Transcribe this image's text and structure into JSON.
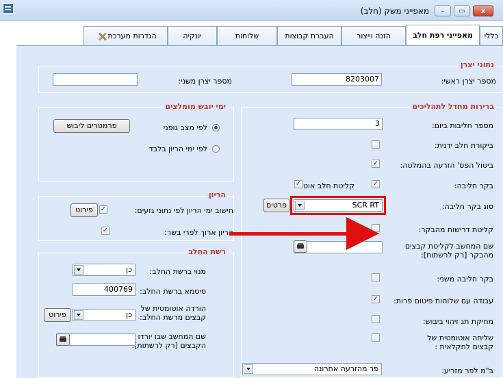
{
  "window": {
    "title": "מאפייני משק (חלב)",
    "controls": {
      "close": "x",
      "maximize": "▭",
      "minimize": "–"
    }
  },
  "tabs": [
    {
      "label": "כללי"
    },
    {
      "label": "מאפייני רפת חלב"
    },
    {
      "label": "הזנה וייצור"
    },
    {
      "label": "העברת קבוצות"
    },
    {
      "label": "שלוחות"
    },
    {
      "label": "יונקיה"
    },
    {
      "label": "הגדרות מערכת",
      "icon": "tools-icon"
    }
  ],
  "producer": {
    "title": "נתוני יצרן",
    "main_label": "מספר יצרן ראשי:",
    "main_value": "8203007",
    "secondary_label": "מספר יצרן משני:",
    "secondary_value": ""
  },
  "defaults": {
    "title": "ברירות מחדל לתהליכים",
    "milkings_label": "מספר חליבות ביום:",
    "milkings_value": "3",
    "manual_check_label": "ביקורת חלב ידנית:",
    "cancel_insem_label": "ביטול הפס' הזרעה בהמלטה:",
    "milking_ctrl_label": "בקר חליבה:",
    "auto_milk_label": "קליטת חלב אוט':",
    "ctrl_type_label": "סוג בקר חליבה:",
    "ctrl_type_value": "SCR RT",
    "details_button": "פרטים",
    "demands_label": "קליטת דרישות מהבקר:",
    "computer_label": "שם המחשב לקליטת קבצים מהבקר [רק לרשתות]:",
    "computer_value": "",
    "secondary_ctrl_label": "בקר חליבה משני:",
    "feeding_label": "עבודה עם שלוחות פיטום פרות:",
    "erase_tag_label": "מחיקת תג זיהוי ביבוש:",
    "auto_send_label": "שליחה אוטומטית של קבצים לחקלאית :",
    "bm_label": "ב\"מ לפר מזריע:",
    "bm_value": "פר מהזרעה אחרונה"
  },
  "dry_days": {
    "title": "ימי יובש מומלצים",
    "params_button": "פרמטרים ליבוש",
    "radio_body": "לפי מצב גופני",
    "radio_pregnancy": "לפי ימי הריון בלבד"
  },
  "pregnancy": {
    "title": "הריון",
    "calc_label": "חישוב ימי הריון לפי נתוני גזעים:",
    "detail_button": "פירוט",
    "long_label": "הריון ארוך לפרי בשר:"
  },
  "milk_net": {
    "title": "רשת החלב",
    "subscriber_label": "מנוי ברשת החלב:",
    "subscriber_value": "כן",
    "password_label": "סיסמא ברשת החלב:",
    "password_value": "400769",
    "auto_download_label": "הורדה אוטומטית של קבצים מרשת החלב:",
    "auto_download_value": "כן",
    "detail_button": "פירוט",
    "computer_label": "שם המחשב שבו יורדו הקבצים [רק לרשתות]:",
    "computer_value": ""
  },
  "checkbox_mark": "✓"
}
